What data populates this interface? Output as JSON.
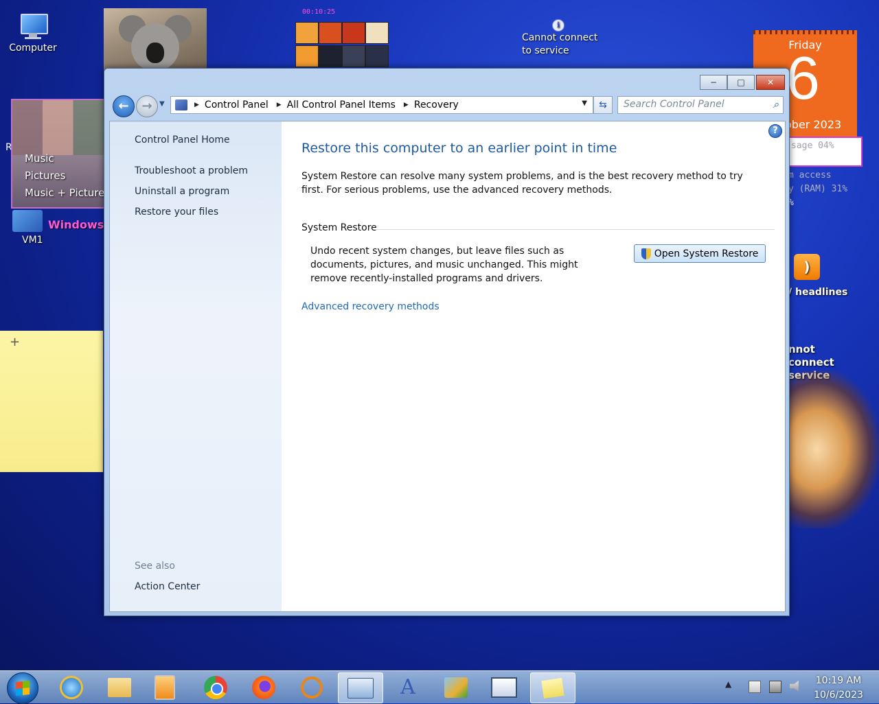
{
  "desktop": {
    "computer_icon_label": "Computer",
    "vm_icon_label": "VM1",
    "vm_icon_badge": "Windows",
    "media_items": [
      "Music",
      "Pictures",
      "Music + Pictures"
    ],
    "media_partial_letter": "R",
    "sticky_add": "+"
  },
  "gadgets": {
    "puzzle_timer": "00:10:25",
    "weather_status": "Cannot connect to service",
    "weather_status_partial": "nnot connect service",
    "calendar_day": "Friday",
    "calendar_date": "6",
    "calendar_month": "ober 2023",
    "meter_cpu": "sage 04%",
    "meter_ram_line1": "m access",
    "meter_ram_line2": "y (RAM) 31%",
    "meter_ram_line3": "%",
    "rss_label": "/ headlines"
  },
  "window": {
    "address": {
      "crumbs": [
        "Control Panel",
        "All Control Panel Items",
        "Recovery"
      ]
    },
    "search_placeholder": "Search Control Panel",
    "left_pane": {
      "home": "Control Panel Home",
      "links": [
        "Troubleshoot a problem",
        "Uninstall a program",
        "Restore your files"
      ],
      "see_also": "See also",
      "see_also_links": [
        "Action Center"
      ]
    },
    "main": {
      "title": "Restore this computer to an earlier point in time",
      "description": "System Restore can resolve many system problems, and is the best recovery method to try first. For serious problems, use the advanced recovery methods.",
      "section_title": "System Restore",
      "section_text": "Undo recent system changes, but leave files such as documents, pictures, and music unchanged. This might remove recently-installed programs and drivers.",
      "open_button": "Open System Restore",
      "advanced_link": "Advanced recovery methods"
    }
  },
  "taskbar": {
    "time": "10:19 AM",
    "date": "10/6/2023",
    "buttons": [
      "internet-explorer",
      "file-explorer",
      "media-player",
      "chrome",
      "firefox",
      "search-tool",
      "control-panel",
      "font-tool",
      "settings-tool",
      "remote-desktop",
      "sticky-notes"
    ]
  }
}
